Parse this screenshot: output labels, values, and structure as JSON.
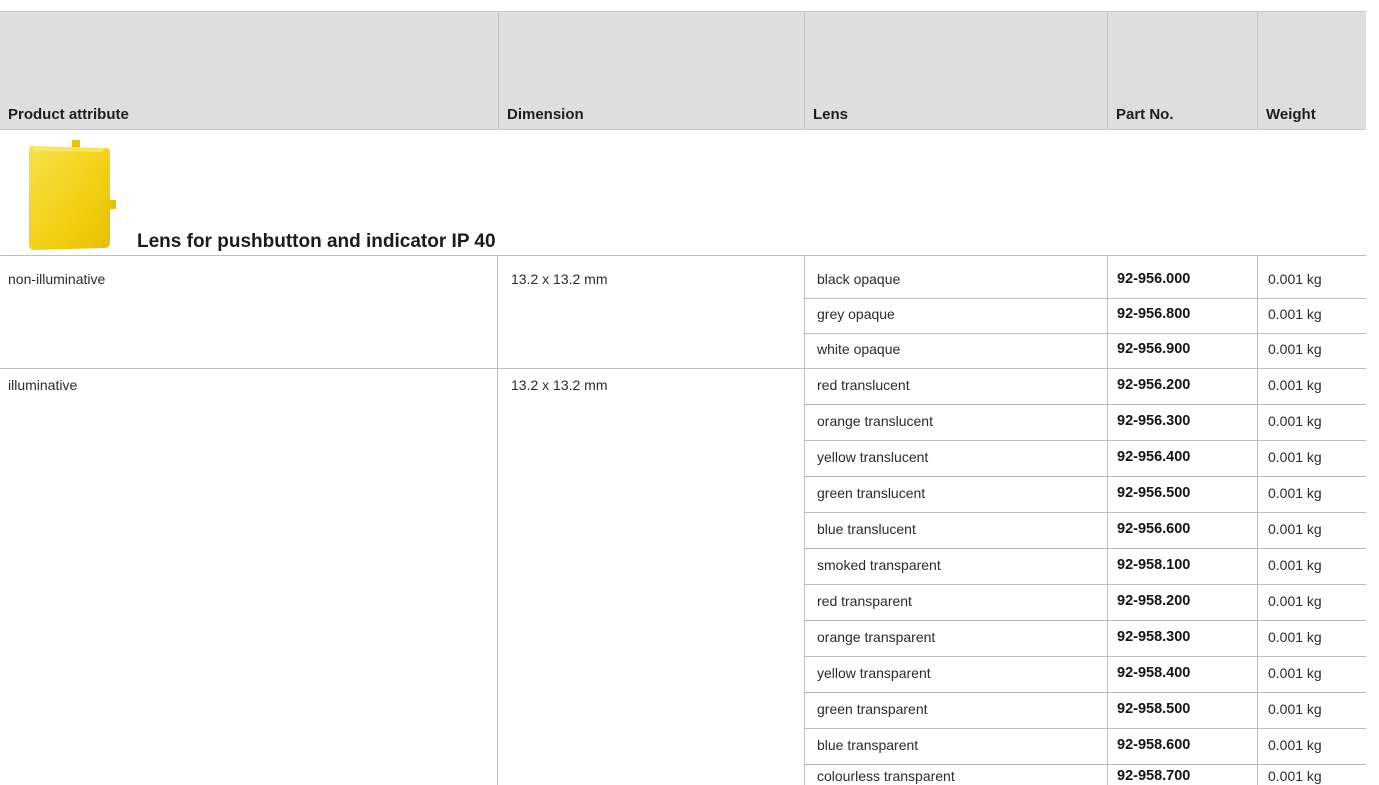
{
  "columns": [
    {
      "label": "Product attribute"
    },
    {
      "label": "Dimension"
    },
    {
      "label": "Lens"
    },
    {
      "label": "Part No."
    },
    {
      "label": "Weight"
    }
  ],
  "product": {
    "title": "Lens for pushbutton and indicator IP 40",
    "image_icon": "yellow-lens-cap-image",
    "image_color": "#f3d21a"
  },
  "groups": [
    {
      "attribute": "non-illuminative",
      "dimension": "13.2 x 13.2 mm",
      "rows": [
        {
          "lens": "black opaque",
          "part_no": "92-956.000",
          "weight": "0.001 kg"
        },
        {
          "lens": "grey opaque",
          "part_no": "92-956.800",
          "weight": "0.001 kg"
        },
        {
          "lens": "white opaque",
          "part_no": "92-956.900",
          "weight": "0.001 kg"
        }
      ]
    },
    {
      "attribute": "illuminative",
      "dimension": "13.2 x 13.2 mm",
      "rows": [
        {
          "lens": "red translucent",
          "part_no": "92-956.200",
          "weight": "0.001 kg"
        },
        {
          "lens": "orange translucent",
          "part_no": "92-956.300",
          "weight": "0.001 kg"
        },
        {
          "lens": "yellow translucent",
          "part_no": "92-956.400",
          "weight": "0.001 kg"
        },
        {
          "lens": "green translucent",
          "part_no": "92-956.500",
          "weight": "0.001 kg"
        },
        {
          "lens": "blue translucent",
          "part_no": "92-956.600",
          "weight": "0.001 kg"
        },
        {
          "lens": "smoked transparent",
          "part_no": "92-958.100",
          "weight": "0.001 kg"
        },
        {
          "lens": "red transparent",
          "part_no": "92-958.200",
          "weight": "0.001 kg"
        },
        {
          "lens": "orange transparent",
          "part_no": "92-958.300",
          "weight": "0.001 kg"
        },
        {
          "lens": "yellow transparent",
          "part_no": "92-958.400",
          "weight": "0.001 kg"
        },
        {
          "lens": "green transparent",
          "part_no": "92-958.500",
          "weight": "0.001 kg"
        },
        {
          "lens": "blue transparent",
          "part_no": "92-958.600",
          "weight": "0.001 kg"
        },
        {
          "lens": "colourless transparent",
          "part_no": "92-958.700",
          "weight": "0.001 kg"
        }
      ]
    }
  ]
}
